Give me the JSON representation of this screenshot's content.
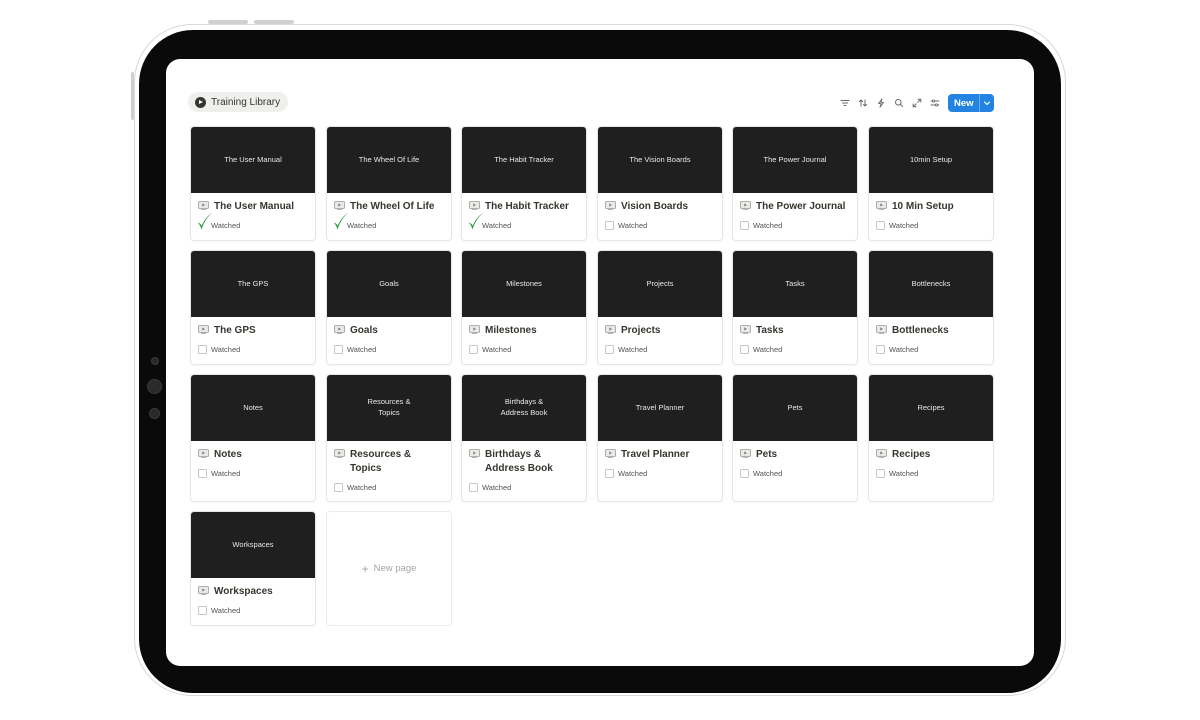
{
  "view": {
    "title": "Training Library",
    "icon": "play-circle-icon"
  },
  "toolbar": {
    "icons": [
      "filter-icon",
      "sort-icon",
      "automation-icon",
      "search-icon",
      "expand-icon",
      "settings-icon"
    ],
    "new_label": "New"
  },
  "cards": [
    {
      "cover": "The User Manual",
      "title": "The User Manual",
      "watched_label": "Watched",
      "watched": true
    },
    {
      "cover": "The Wheel Of Life",
      "title": "The Wheel Of Life",
      "watched_label": "Watched",
      "watched": true
    },
    {
      "cover": "The Habit Tracker",
      "title": "The Habit Tracker",
      "watched_label": "Watched",
      "watched": true
    },
    {
      "cover": "The Vision Boards",
      "title": "Vision Boards",
      "watched_label": "Watched",
      "watched": false
    },
    {
      "cover": "The Power Journal",
      "title": "The Power Journal",
      "watched_label": "Watched",
      "watched": false
    },
    {
      "cover": "10min Setup",
      "title": "10 Min Setup",
      "watched_label": "Watched",
      "watched": false
    },
    {
      "cover": "The GPS",
      "title": "The GPS",
      "watched_label": "Watched",
      "watched": false
    },
    {
      "cover": "Goals",
      "title": "Goals",
      "watched_label": "Watched",
      "watched": false
    },
    {
      "cover": "Milestones",
      "title": "Milestones",
      "watched_label": "Watched",
      "watched": false
    },
    {
      "cover": "Projects",
      "title": "Projects",
      "watched_label": "Watched",
      "watched": false
    },
    {
      "cover": "Tasks",
      "title": "Tasks",
      "watched_label": "Watched",
      "watched": false
    },
    {
      "cover": "Bottlenecks",
      "title": "Bottlenecks",
      "watched_label": "Watched",
      "watched": false
    },
    {
      "cover": "Notes",
      "title": "Notes",
      "watched_label": "Watched",
      "watched": false
    },
    {
      "cover": "Resources &\nTopics",
      "title": "Resources & Topics",
      "watched_label": "Watched",
      "watched": false
    },
    {
      "cover": "Birthdays &\nAddress Book",
      "title": "Birthdays & Address Book",
      "watched_label": "Watched",
      "watched": false
    },
    {
      "cover": "Travel Planner",
      "title": "Travel Planner",
      "watched_label": "Watched",
      "watched": false
    },
    {
      "cover": "Pets",
      "title": "Pets",
      "watched_label": "Watched",
      "watched": false
    },
    {
      "cover": "Recipes",
      "title": "Recipes",
      "watched_label": "Watched",
      "watched": false
    },
    {
      "cover": "Workspaces",
      "title": "Workspaces",
      "watched_label": "Watched",
      "watched": false
    }
  ],
  "new_page_label": "New page",
  "colors": {
    "accent": "#2383e2",
    "cover": "#1f1f1f",
    "checkmark": "#2e9e3a"
  }
}
